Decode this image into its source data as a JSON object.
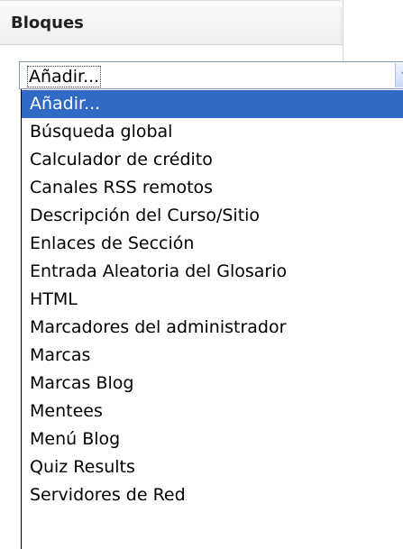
{
  "block": {
    "title": "Bloques"
  },
  "select": {
    "value": "Añadir...",
    "arrow_icon": "chevron-down-icon"
  },
  "dropdown": {
    "highlight_color": "#316ac5",
    "options": [
      "Añadir...",
      "Búsqueda global",
      "Calculador de crédito",
      "Canales RSS remotos",
      "Descripción del Curso/Sitio",
      "Enlaces de Sección",
      "Entrada Aleatoria del Glosario",
      "HTML",
      "Marcadores del administrador",
      "Marcas",
      "Marcas Blog",
      "Mentees",
      "Menú Blog",
      "Quiz Results",
      "Servidores de Red"
    ],
    "selected_index": 0
  }
}
